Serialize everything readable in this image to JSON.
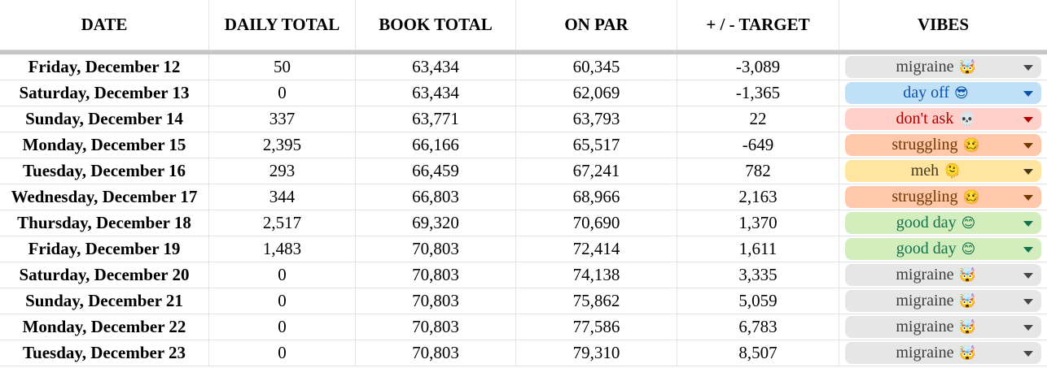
{
  "headers": [
    "DATE",
    "DAILY TOTAL",
    "BOOK TOTAL",
    "ON PAR",
    "+ / - TARGET",
    "VIBES"
  ],
  "vibe_styles": {
    "migraine": {
      "bg": "#e6e6e6",
      "fg": "#3d3d3d",
      "caret": "#474747",
      "emoji": "🤯",
      "icon": "exploding-head-icon"
    },
    "day off": {
      "bg": "#bfe0f6",
      "fg": "#0a53a8",
      "caret": "#0a53a8",
      "emoji": "😎",
      "icon": "sunglasses-face-icon"
    },
    "don't ask": {
      "bg": "#ffcfc9",
      "fg": "#b10202",
      "caret": "#b10202",
      "emoji": "💀",
      "icon": "skull-icon"
    },
    "struggling": {
      "bg": "#ffc8aa",
      "fg": "#753800",
      "caret": "#753800",
      "emoji": "🥴",
      "icon": "woozy-face-icon"
    },
    "meh": {
      "bg": "#ffe5a0",
      "fg": "#473821",
      "caret": "#473821",
      "emoji": "🫠",
      "icon": "melting-face-icon"
    },
    "good day": {
      "bg": "#d4edbc",
      "fg": "#11734b",
      "caret": "#11734b",
      "emoji": "😊",
      "icon": "smiling-face-icon"
    }
  },
  "rows": [
    {
      "date": "Friday, December 12",
      "daily": "50",
      "book": "63,434",
      "par": "60,345",
      "target": "-3,089",
      "vibe": "migraine"
    },
    {
      "date": "Saturday, December 13",
      "daily": "0",
      "book": "63,434",
      "par": "62,069",
      "target": "-1,365",
      "vibe": "day off"
    },
    {
      "date": "Sunday, December 14",
      "daily": "337",
      "book": "63,771",
      "par": "63,793",
      "target": "22",
      "vibe": "don't ask"
    },
    {
      "date": "Monday, December 15",
      "daily": "2,395",
      "book": "66,166",
      "par": "65,517",
      "target": "-649",
      "vibe": "struggling"
    },
    {
      "date": "Tuesday, December 16",
      "daily": "293",
      "book": "66,459",
      "par": "67,241",
      "target": "782",
      "vibe": "meh"
    },
    {
      "date": "Wednesday, December 17",
      "daily": "344",
      "book": "66,803",
      "par": "68,966",
      "target": "2,163",
      "vibe": "struggling"
    },
    {
      "date": "Thursday, December 18",
      "daily": "2,517",
      "book": "69,320",
      "par": "70,690",
      "target": "1,370",
      "vibe": "good day"
    },
    {
      "date": "Friday, December 19",
      "daily": "1,483",
      "book": "70,803",
      "par": "72,414",
      "target": "1,611",
      "vibe": "good day"
    },
    {
      "date": "Saturday, December 20",
      "daily": "0",
      "book": "70,803",
      "par": "74,138",
      "target": "3,335",
      "vibe": "migraine"
    },
    {
      "date": "Sunday, December 21",
      "daily": "0",
      "book": "70,803",
      "par": "75,862",
      "target": "5,059",
      "vibe": "migraine"
    },
    {
      "date": "Monday, December 22",
      "daily": "0",
      "book": "70,803",
      "par": "77,586",
      "target": "6,783",
      "vibe": "migraine"
    },
    {
      "date": "Tuesday, December 23",
      "daily": "0",
      "book": "70,803",
      "par": "79,310",
      "target": "8,507",
      "vibe": "migraine"
    }
  ]
}
